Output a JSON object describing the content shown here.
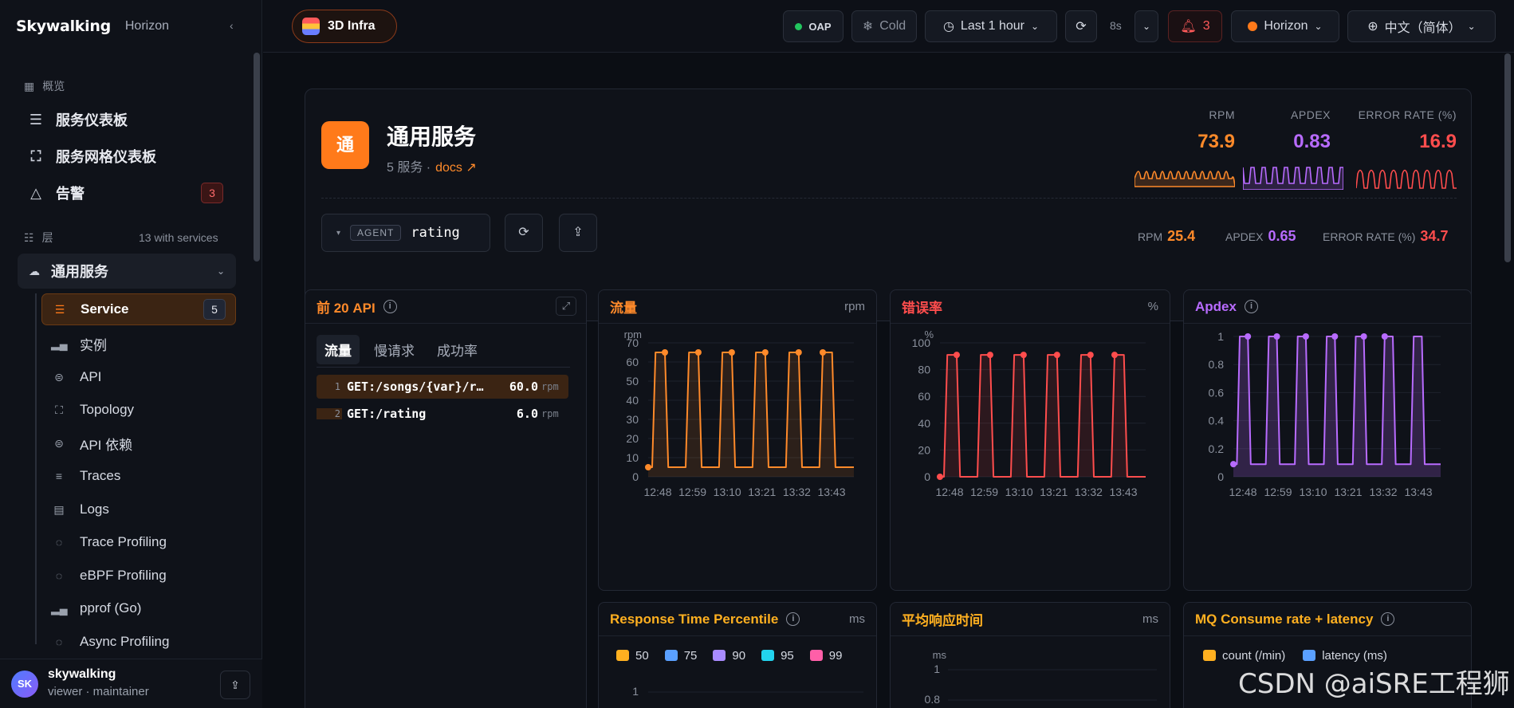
{
  "brand": {
    "logo": "Skywalking",
    "product": "Horizon"
  },
  "sidebar": {
    "overview_label": "概览",
    "items": [
      {
        "label": "服务仪表板"
      },
      {
        "label": "服务网格仪表板"
      },
      {
        "label": "告警",
        "badge": "3"
      }
    ],
    "layers_label": "层",
    "layers_count": "13 with services",
    "group": {
      "label": "通用服务"
    },
    "sub_items": [
      {
        "label": "Service",
        "count": "5"
      },
      {
        "label": "实例"
      },
      {
        "label": "API"
      },
      {
        "label": "Topology"
      },
      {
        "label": "API 依赖"
      },
      {
        "label": "Traces"
      },
      {
        "label": "Logs"
      },
      {
        "label": "Trace Profiling"
      },
      {
        "label": "eBPF Profiling"
      },
      {
        "label": "pprof (Go)"
      },
      {
        "label": "Async Profiling"
      }
    ],
    "user": {
      "initials": "SK",
      "name": "skywalking",
      "role": "viewer · maintainer"
    }
  },
  "topbar": {
    "infra_label": "3D Infra",
    "oap_label": "OAP",
    "cold_label": "Cold",
    "time_label": "Last 1 hour",
    "refresh_interval": "8s",
    "alerts_count": "3",
    "theme_label": "Horizon",
    "lang_label": "中文（简体）"
  },
  "hero": {
    "icon_text": "通",
    "title": "通用服务",
    "subtitle": "5 服务 ·",
    "docs_label": "docs ↗",
    "metrics": [
      {
        "label": "RPM",
        "value": "73.9",
        "color": "#ff8a2a"
      },
      {
        "label": "APDEX",
        "value": "0.83",
        "color": "#b86bff"
      },
      {
        "label": "ERROR RATE (%)",
        "value": "16.9",
        "color": "#ff4d4d"
      }
    ],
    "service": {
      "tag": "AGENT",
      "name": "rating"
    },
    "inline_metrics": [
      {
        "label": "RPM",
        "value": "25.4",
        "color": "#ff8a2a"
      },
      {
        "label": "APDEX",
        "value": "0.65",
        "color": "#b86bff"
      },
      {
        "label": "ERROR RATE (%)",
        "value": "34.7",
        "color": "#ff4d4d"
      }
    ]
  },
  "panels": {
    "top_api": {
      "title": "前 20 API",
      "tabs": [
        "流量",
        "慢请求",
        "成功率"
      ],
      "rows": [
        {
          "idx": "1",
          "path": "GET:/songs/{var}/r…",
          "value": "60.0",
          "unit": "rpm"
        },
        {
          "idx": "2",
          "path": "GET:/rating",
          "value": "6.0",
          "unit": "rpm"
        }
      ]
    },
    "traffic": {
      "title": "流量",
      "unit": "rpm"
    },
    "error": {
      "title": "错误率",
      "unit": "%"
    },
    "apdex": {
      "title": "Apdex"
    },
    "resp_pct": {
      "title": "Response Time Percentile",
      "unit": "ms",
      "legend": [
        "50",
        "75",
        "90",
        "95",
        "99"
      ]
    },
    "avg_resp": {
      "title": "平均响应时间",
      "unit": "ms"
    },
    "mq": {
      "title": "MQ Consume rate + latency",
      "legend": [
        "count (/min)",
        "latency (ms)"
      ]
    }
  },
  "chart_data": [
    {
      "type": "line",
      "ylabel": "rpm",
      "ylim": [
        0,
        70
      ],
      "yticks": [
        0,
        10,
        20,
        30,
        40,
        50,
        60,
        70
      ],
      "x": [
        "12:48",
        "12:59",
        "13:10",
        "13:21",
        "13:32",
        "13:43"
      ],
      "pattern": {
        "low": 5,
        "high": 65,
        "peaks": 6
      },
      "color": "#ff8a2a"
    },
    {
      "type": "line",
      "ylabel": "%",
      "ylim": [
        0,
        100
      ],
      "yticks": [
        0,
        20,
        40,
        60,
        80,
        100
      ],
      "x": [
        "12:48",
        "12:59",
        "13:10",
        "13:21",
        "13:32",
        "13:43"
      ],
      "pattern": {
        "low": 0,
        "high": 91,
        "peaks": 6
      },
      "color": "#ff4d4d"
    },
    {
      "type": "area",
      "ylim": [
        0,
        1
      ],
      "yticks": [
        0,
        0.2,
        0.4,
        0.6,
        0.8,
        1
      ],
      "x": [
        "12:48",
        "12:59",
        "13:10",
        "13:21",
        "13:32",
        "13:43"
      ],
      "pattern": {
        "low": 0.09,
        "high": 1,
        "peaks": 7
      },
      "color": "#b86bff"
    }
  ],
  "colors": {
    "accent": "#ff7a1a",
    "traffic": "#ff8a2a",
    "error": "#ff4d4d",
    "apdex": "#b86bff",
    "percentile_50": "#ffb020",
    "percentile_75": "#5aa0ff",
    "percentile_90": "#a98bff",
    "percentile_95": "#22d3ee",
    "percentile_99": "#ff5fa8"
  },
  "watermark": "CSDN @aiSRE工程狮"
}
